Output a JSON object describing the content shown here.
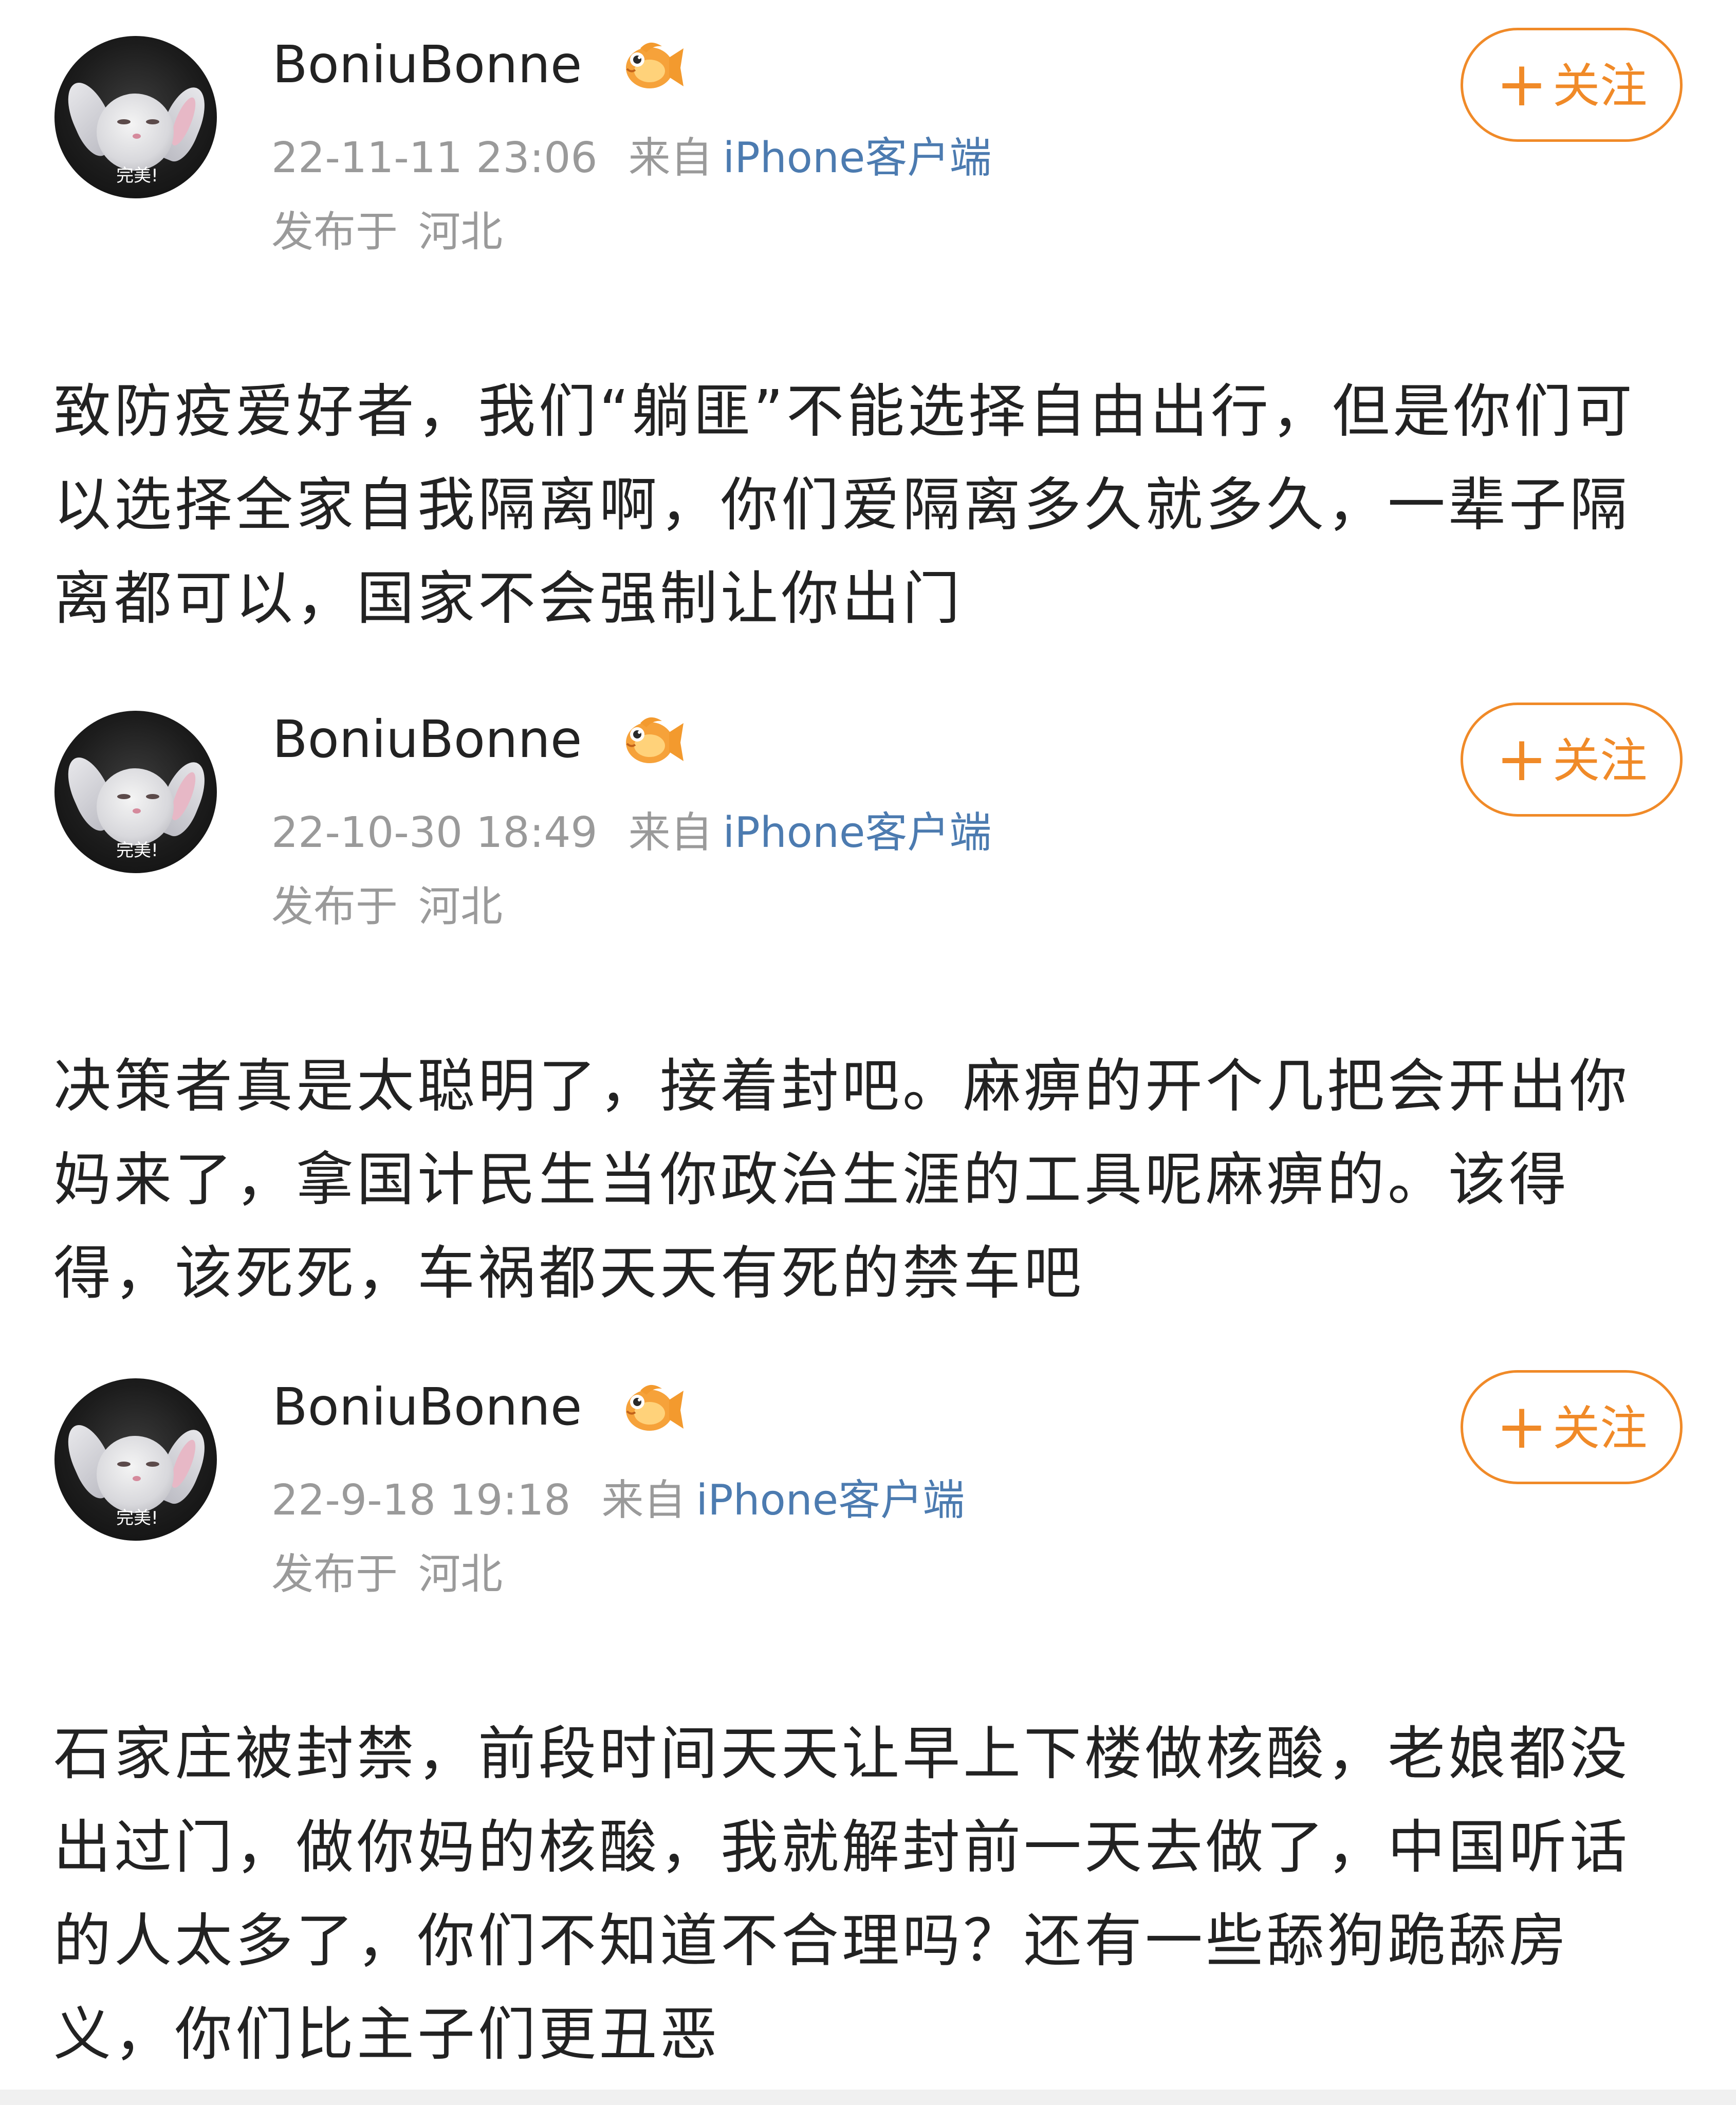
{
  "posts": [
    {
      "username": "BoniuBonne",
      "avatar_caption": "完美!",
      "badge_icon": "goldfish-badge-icon",
      "timestamp": "22-11-11 23:06",
      "from_label": "来自",
      "client": "iPhone客户端",
      "location_label": "发布于",
      "location": "河北",
      "follow_label": "关注",
      "content": "致防疫爱好者，我们“躺匪”不能选择自由出行，但是你们可以选择全家自我隔离啊，你们爱隔离多久就多久，一辈子隔离都可以，国家不会强制让你出门"
    },
    {
      "username": "BoniuBonne",
      "avatar_caption": "完美!",
      "badge_icon": "goldfish-badge-icon",
      "timestamp": "22-10-30 18:49",
      "from_label": "来自",
      "client": "iPhone客户端",
      "location_label": "发布于",
      "location": "河北",
      "follow_label": "关注",
      "content": "决策者真是太聪明了，接着封吧。麻痹的开个几把会开出你妈来了，拿国计民生当你政治生涯的工具呢麻痹的。该得得，该死死，车祸都天天有死的禁车吧"
    },
    {
      "username": "BoniuBonne",
      "avatar_caption": "完美!",
      "badge_icon": "goldfish-badge-icon",
      "timestamp": "22-9-18 19:18",
      "from_label": "来自",
      "client": "iPhone客户端",
      "location_label": "发布于",
      "location": "河北",
      "follow_label": "关注",
      "content": "石家庄被封禁，前段时间天天让早上下楼做核酸，老娘都没出过门，做你妈的核酸，我就解封前一天去做了，中国听话的人太多了，你们不知道不合理吗？还有一些舔狗跪舔房义，你们比主子们更丑恶"
    }
  ],
  "colors": {
    "accent": "#f08a28",
    "link": "#4c7bb0",
    "meta": "#9a9a9a",
    "text": "#222222"
  }
}
